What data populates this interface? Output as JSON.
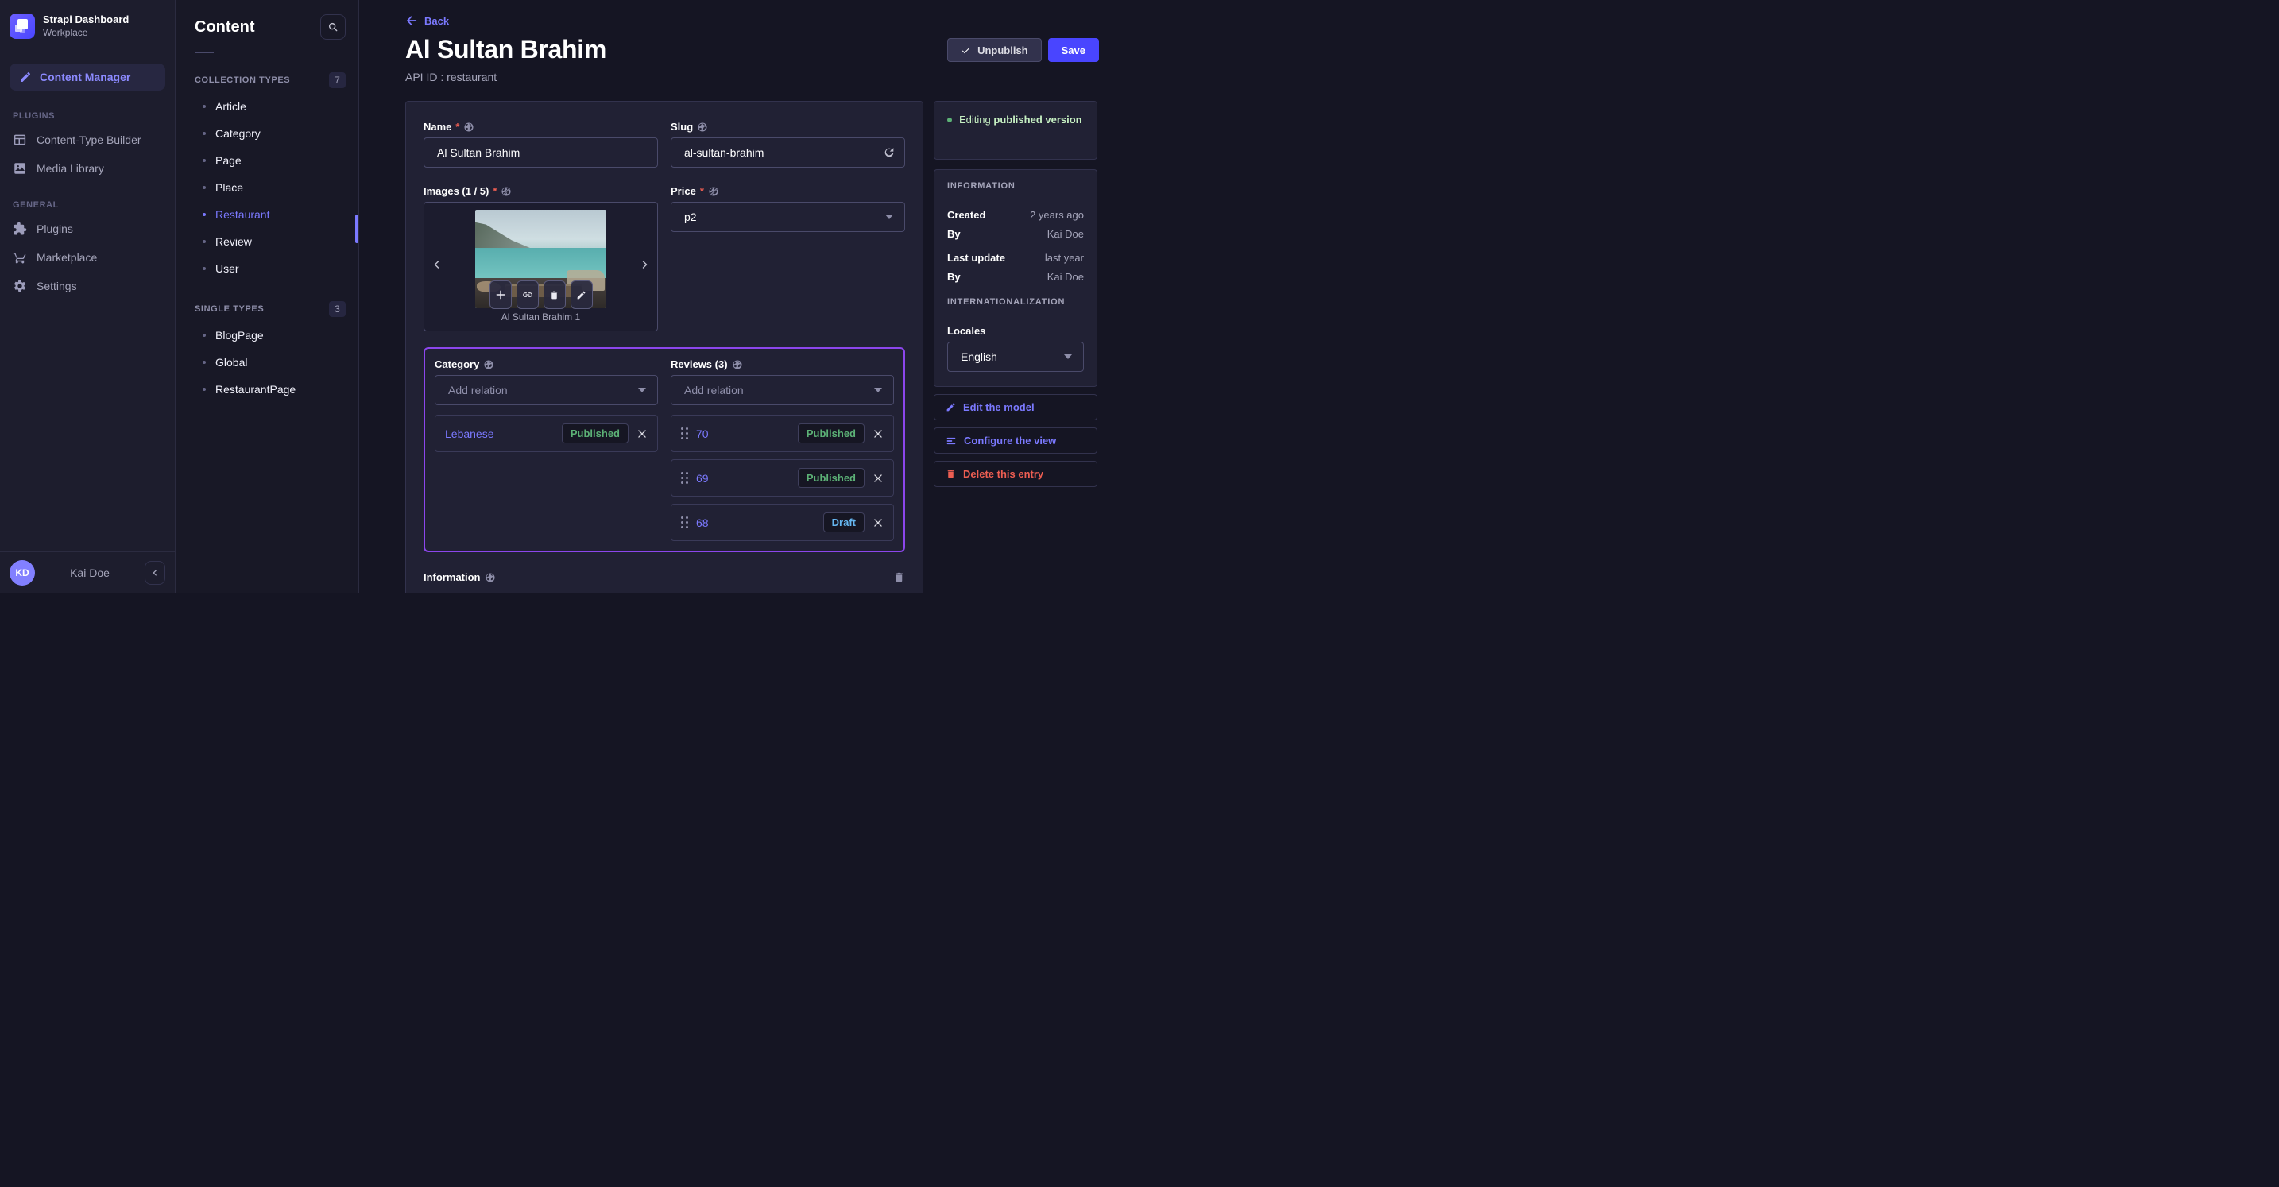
{
  "colors": {
    "accent": "#4945ff",
    "link_purple": "#7b79ff",
    "relations_focus_border": "#8c46ec",
    "success_green": "#5cb176",
    "success_text_light": "#c6f0c2",
    "draft_blue": "#66b7f1",
    "danger_red": "#ee5e52"
  },
  "nav": {
    "brand": {
      "title": "Strapi Dashboard",
      "subtitle": "Workplace"
    },
    "content_manager": "Content Manager",
    "sections": [
      {
        "label": "PLUGINS",
        "items": [
          {
            "label": "Content-Type Builder"
          },
          {
            "label": "Media Library"
          }
        ]
      },
      {
        "label": "GENERAL",
        "items": [
          {
            "label": "Plugins"
          },
          {
            "label": "Marketplace"
          },
          {
            "label": "Settings"
          }
        ]
      }
    ],
    "user": {
      "initials": "KD",
      "name": "Kai Doe"
    }
  },
  "subnav": {
    "title": "Content",
    "groups": [
      {
        "label": "COLLECTION TYPES",
        "count": "7",
        "items": [
          "Article",
          "Category",
          "Page",
          "Place",
          "Restaurant",
          "Review",
          "User"
        ]
      },
      {
        "label": "SINGLE TYPES",
        "count": "3",
        "items": [
          "BlogPage",
          "Global",
          "RestaurantPage"
        ]
      }
    ],
    "active_item": "Restaurant"
  },
  "header": {
    "back": "Back",
    "title": "Al Sultan Brahim",
    "api_id": "API ID : restaurant",
    "unpublish": "Unpublish",
    "save": "Save"
  },
  "form": {
    "required_mark": "*",
    "name": {
      "label": "Name",
      "value": "Al Sultan Brahim"
    },
    "slug": {
      "label": "Slug",
      "value": "al-sultan-brahim"
    },
    "images": {
      "label": "Images (1 / 5)",
      "caption": "Al Sultan Brahim 1"
    },
    "price": {
      "label": "Price",
      "value": "p2"
    },
    "category": {
      "label": "Category",
      "placeholder": "Add relation",
      "relations": [
        {
          "name": "Lebanese",
          "status": "Published"
        }
      ]
    },
    "reviews": {
      "label": "Reviews (3)",
      "placeholder": "Add relation",
      "relations": [
        {
          "name": "70",
          "status": "Published"
        },
        {
          "name": "69",
          "status": "Published"
        },
        {
          "name": "68",
          "status": "Draft"
        }
      ]
    },
    "component": {
      "label": "Information"
    }
  },
  "panel": {
    "editing": {
      "prefix": "Editing ",
      "bold": "published version"
    },
    "information": {
      "title": "INFORMATION",
      "rows": [
        {
          "label": "Created",
          "value": "2 years ago"
        },
        {
          "label": "By",
          "value": "Kai Doe"
        },
        {
          "label": "Last update",
          "value": "last year"
        },
        {
          "label": "By",
          "value": "Kai Doe"
        }
      ]
    },
    "i18n": {
      "title": "INTERNATIONALIZATION",
      "locales_label": "Locales",
      "locale": "English"
    },
    "actions": [
      {
        "label": "Edit the model"
      },
      {
        "label": "Configure the view"
      },
      {
        "label": "Delete this entry"
      }
    ]
  }
}
